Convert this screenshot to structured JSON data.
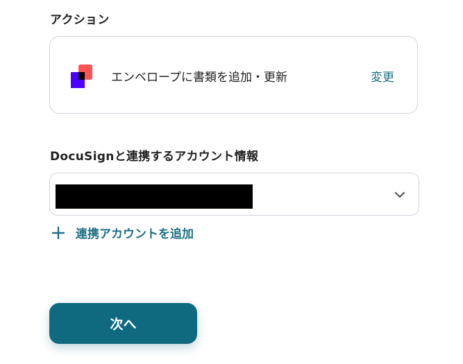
{
  "action": {
    "section_label": "アクション",
    "app_icon": "docusign-icon",
    "name": "エンベロープに書類を追加・更新",
    "change_label": "変更"
  },
  "account": {
    "section_label": "DocuSignと連携するアカウント情報",
    "selected_value": "",
    "chevron_icon": "chevron-down-icon",
    "add_account_label": "連携アカウントを追加",
    "add_icon": "plus-icon"
  },
  "footer": {
    "next_label": "次へ"
  },
  "colors": {
    "accent": "#1f6f82",
    "button": "#0f6a80",
    "brand_primary": "#4c00ff",
    "brand_secondary": "#ff5252"
  }
}
